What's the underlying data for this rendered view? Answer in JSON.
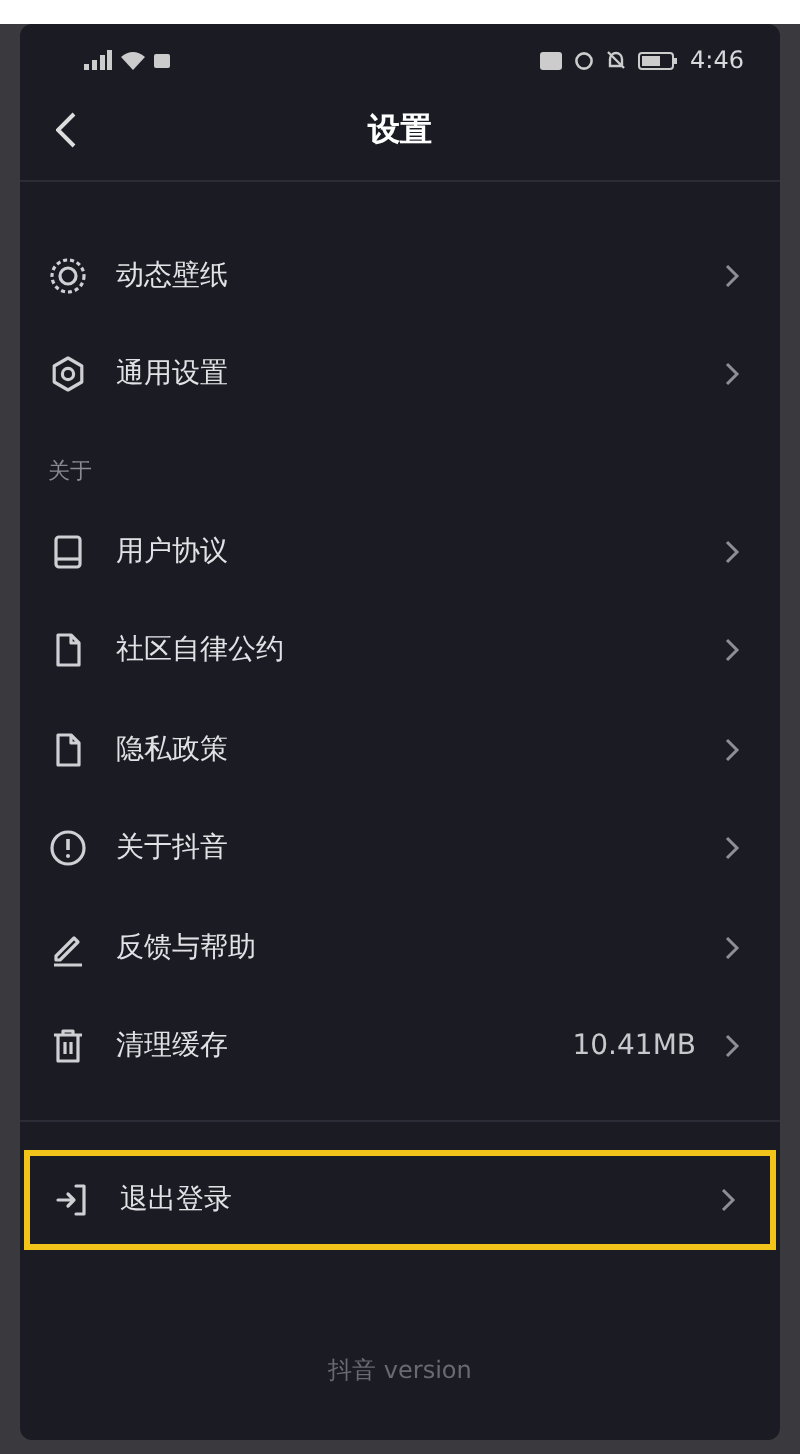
{
  "status_bar": {
    "time": "4:46"
  },
  "header": {
    "title": "设置"
  },
  "groups": [
    {
      "items": [
        {
          "kind": "wallpaper",
          "label": "动态壁纸"
        },
        {
          "kind": "gear",
          "label": "通用设置"
        }
      ]
    },
    {
      "title": "关于",
      "items": [
        {
          "kind": "book",
          "label": "用户协议"
        },
        {
          "kind": "document",
          "label": "社区自律公约"
        },
        {
          "kind": "document",
          "label": "隐私政策"
        },
        {
          "kind": "info",
          "label": "关于抖音"
        },
        {
          "kind": "pencil",
          "label": "反馈与帮助"
        },
        {
          "kind": "trash",
          "label": "清理缓存",
          "value": "10.41MB"
        }
      ]
    },
    {
      "items": [
        {
          "kind": "logout",
          "label": "退出登录",
          "highlighted": true
        }
      ]
    }
  ],
  "footer": {
    "version": "抖音 version"
  }
}
